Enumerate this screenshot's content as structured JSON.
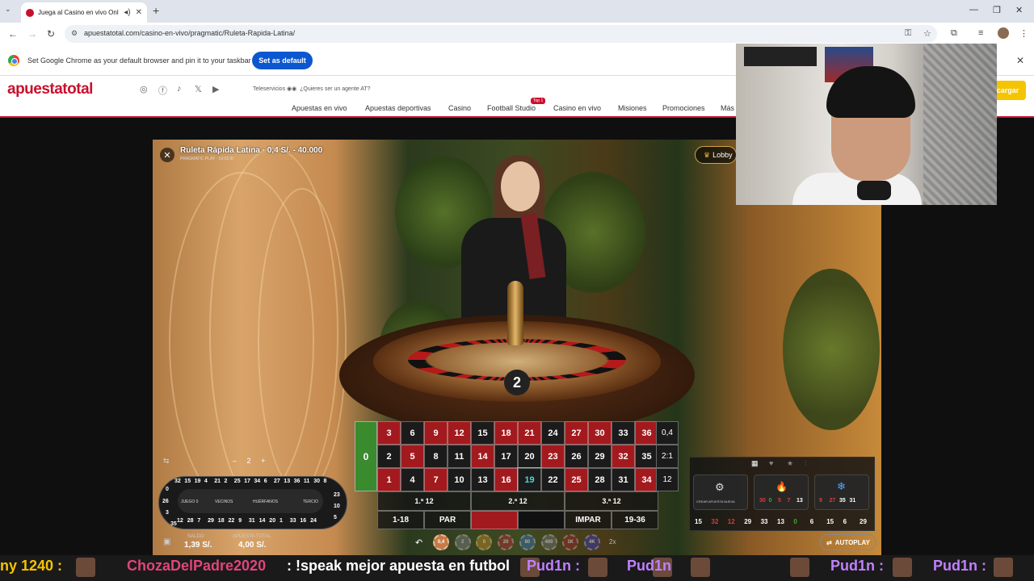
{
  "browser": {
    "tab_title": "Juega al Casino en vivo Onl",
    "url": "apuestatotal.com/casino-en-vivo/pragmatic/Ruleta-Rapida-Latina/",
    "infobar_text": "Set Google Chrome as your default browser and pin it to your taskbar",
    "set_default_label": "Set as default"
  },
  "site": {
    "logo": "apuestatotal",
    "teleservicios": "Teleservicios",
    "agent": "¿Quieres ser un agente AT?",
    "menu": [
      "Apuestas en vivo",
      "Apuestas deportivas",
      "Casino",
      "Football Studio",
      "Casino en vivo",
      "Misiones",
      "Promociones",
      "Más"
    ],
    "top_badge": "Top 1",
    "recargar": "cargar"
  },
  "game": {
    "title": "Ruleta Rápida Latina · 0,4 S/. - 40.000",
    "subtitle": "PRAGMATIC PLAY · 19:03 ID",
    "lobby_label": "Lobby",
    "result": "2",
    "board": {
      "zero": "0",
      "rows": [
        [
          3,
          6,
          9,
          12,
          15,
          18,
          21,
          24,
          27,
          30,
          33,
          36
        ],
        [
          2,
          5,
          8,
          11,
          14,
          17,
          20,
          23,
          26,
          29,
          32,
          35
        ],
        [
          1,
          4,
          7,
          10,
          13,
          16,
          19,
          22,
          25,
          28,
          31,
          34
        ]
      ],
      "red_numbers": [
        1,
        3,
        5,
        7,
        9,
        12,
        14,
        16,
        18,
        19,
        21,
        23,
        25,
        27,
        30,
        32,
        34,
        36
      ],
      "col_labels": [
        "0,4",
        "2:1",
        "12"
      ],
      "dozens": [
        "1.ª 12",
        "2.ª 12",
        "3.ª 12"
      ],
      "outside": [
        "1-18",
        "PAR",
        "",
        "",
        "IMPAR",
        "19-36"
      ]
    },
    "racetrack": {
      "labels": [
        "JUEGO 0",
        "VECINOS",
        "HUÉRFANOS",
        "TERCIO"
      ],
      "top_numbers": [
        "32",
        "15",
        "19",
        "4",
        "21",
        "2",
        "25",
        "17",
        "34",
        "6",
        "27",
        "13",
        "36",
        "11",
        "30",
        "8"
      ],
      "bottom_numbers": [
        "12",
        "28",
        "7",
        "29",
        "18",
        "22",
        "9",
        "31",
        "14",
        "20",
        "1",
        "33",
        "16",
        "24"
      ],
      "left_numbers": [
        "0",
        "26",
        "3",
        "35"
      ],
      "right_numbers": [
        "23",
        "10",
        "5"
      ],
      "stepper": "2"
    },
    "saldo_label": "SALDO",
    "saldo_value": "1,39 S/.",
    "apuesta_label": "APUESTA TOTAL",
    "apuesta_value": "4,00 S/.",
    "chips": [
      "0,4",
      "2",
      "8",
      "20",
      "80",
      "400",
      "1K",
      "4K"
    ],
    "multiplier": "2x",
    "autoplay_label": "AUTOPLAY",
    "crear_apuesta": "CREAR APUESTA NUEVA",
    "hot_numbers": [
      "30",
      "0",
      "5",
      "7",
      "13"
    ],
    "cold_numbers": [
      "9",
      "27",
      "35",
      "31"
    ],
    "last_numbers": [
      "15",
      "32",
      "12",
      "29",
      "33",
      "13",
      "0",
      "6",
      "15",
      "6",
      "29"
    ]
  },
  "ticker": {
    "items": [
      {
        "text": "ny 1240 :",
        "color": "#f5c400"
      },
      {
        "text": "ChozaDelPadre2020",
        "color": "#e0457b"
      },
      {
        "text": ": !speak mejor apuesta en futbol",
        "color": "#ffffff"
      },
      {
        "text": "Pud1n :",
        "color": "#c080ff"
      },
      {
        "text": "Pud1n",
        "color": "#c080ff"
      },
      {
        "text": "Pud1n :",
        "color": "#c080ff"
      },
      {
        "text": "Pud1n :",
        "color": "#c080ff"
      },
      {
        "text": "Pud1n :",
        "color": "#c080ff"
      }
    ]
  }
}
